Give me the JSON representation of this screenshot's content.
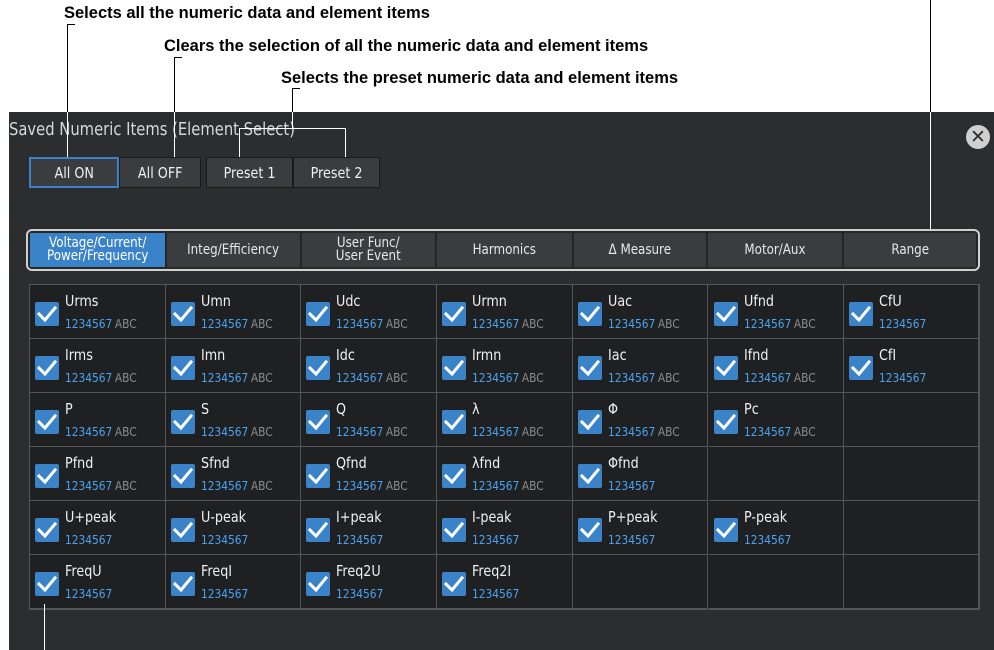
{
  "callouts": {
    "all_on": "Selects all the numeric data and element items",
    "all_off": "Clears the selection of all the numeric data and element items",
    "preset": "Selects the preset numeric data and element items"
  },
  "dialog": {
    "title": "Saved Numeric Items (Element Select)",
    "close_icon": "close-icon"
  },
  "buttons": {
    "all_on": "All ON",
    "all_off": "All OFF",
    "preset1": "Preset 1",
    "preset2": "Preset 2"
  },
  "tabs": [
    {
      "line1": "Voltage/Current/",
      "line2": "Power/Frequency"
    },
    {
      "line1": "Integ/Efficiency",
      "line2": ""
    },
    {
      "line1": "User Func/",
      "line2": "User Event"
    },
    {
      "line1": "Harmonics",
      "line2": ""
    },
    {
      "line1": "Δ Measure",
      "line2": ""
    },
    {
      "line1": "Motor/Aux",
      "line2": ""
    },
    {
      "line1": "Range",
      "line2": ""
    }
  ],
  "active_tab": 0,
  "grid": [
    [
      {
        "name": "Urms",
        "value": "1234567",
        "unit": "ABC"
      },
      {
        "name": "Umn",
        "value": "1234567",
        "unit": "ABC"
      },
      {
        "name": "Udc",
        "value": "1234567",
        "unit": "ABC"
      },
      {
        "name": "Urmn",
        "value": "1234567",
        "unit": "ABC"
      },
      {
        "name": "Uac",
        "value": "1234567",
        "unit": "ABC"
      },
      {
        "name": "Ufnd",
        "value": "1234567",
        "unit": "ABC"
      },
      {
        "name": "CfU",
        "value": "1234567",
        "unit": ""
      }
    ],
    [
      {
        "name": "Irms",
        "value": "1234567",
        "unit": "ABC"
      },
      {
        "name": "Imn",
        "value": "1234567",
        "unit": "ABC"
      },
      {
        "name": "Idc",
        "value": "1234567",
        "unit": "ABC"
      },
      {
        "name": "Irmn",
        "value": "1234567",
        "unit": "ABC"
      },
      {
        "name": "Iac",
        "value": "1234567",
        "unit": "ABC"
      },
      {
        "name": "Ifnd",
        "value": "1234567",
        "unit": "ABC"
      },
      {
        "name": "CfI",
        "value": "1234567",
        "unit": ""
      }
    ],
    [
      {
        "name": "P",
        "value": "1234567",
        "unit": "ABC"
      },
      {
        "name": "S",
        "value": "1234567",
        "unit": "ABC"
      },
      {
        "name": "Q",
        "value": "1234567",
        "unit": "ABC"
      },
      {
        "name": "λ",
        "value": "1234567",
        "unit": "ABC"
      },
      {
        "name": "Φ",
        "value": "1234567",
        "unit": "ABC"
      },
      {
        "name": "Pc",
        "value": "1234567",
        "unit": "ABC"
      },
      null
    ],
    [
      {
        "name": "Pfnd",
        "value": "1234567",
        "unit": "ABC"
      },
      {
        "name": "Sfnd",
        "value": "1234567",
        "unit": "ABC"
      },
      {
        "name": "Qfnd",
        "value": "1234567",
        "unit": "ABC"
      },
      {
        "name": "λfnd",
        "value": "1234567",
        "unit": "ABC"
      },
      {
        "name": "Φfnd",
        "value": "1234567",
        "unit": ""
      },
      null,
      null
    ],
    [
      {
        "name": "U+peak",
        "value": "1234567",
        "unit": ""
      },
      {
        "name": "U-peak",
        "value": "1234567",
        "unit": ""
      },
      {
        "name": "I+peak",
        "value": "1234567",
        "unit": ""
      },
      {
        "name": "I-peak",
        "value": "1234567",
        "unit": ""
      },
      {
        "name": "P+peak",
        "value": "1234567",
        "unit": ""
      },
      {
        "name": "P-peak",
        "value": "1234567",
        "unit": ""
      },
      null
    ],
    [
      {
        "name": "FreqU",
        "value": "1234567",
        "unit": ""
      },
      {
        "name": "FreqI",
        "value": "1234567",
        "unit": ""
      },
      {
        "name": "Freq2U",
        "value": "1234567",
        "unit": ""
      },
      {
        "name": "Freq2I",
        "value": "1234567",
        "unit": ""
      },
      null,
      null,
      null
    ]
  ],
  "colors": {
    "accent": "#3b83c8",
    "value_text": "#4aa3f0",
    "panel_bg": "#2b2d2f"
  }
}
